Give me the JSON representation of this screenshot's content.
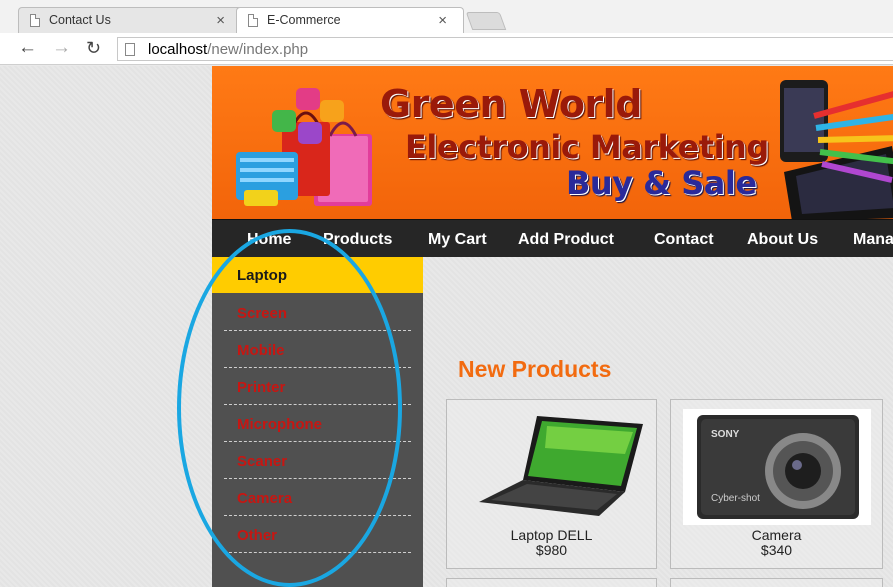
{
  "browser": {
    "tabs": [
      {
        "title": "Contact Us",
        "active": false
      },
      {
        "title": "E-Commerce",
        "active": true
      }
    ],
    "close_glyph": "×",
    "url_host": "localhost",
    "url_path": "/new/index.php",
    "icons": {
      "back": "back-arrow-icon",
      "forward": "forward-arrow-icon",
      "reload": "reload-icon",
      "page": "page-icon"
    }
  },
  "banner": {
    "line1": "Green World",
    "line2": "Electronic Marketing",
    "line3": "Buy & Sale",
    "colors": {
      "background": "#f26b10",
      "title": "#9a1a0a",
      "subtitle": "#2a2a9a"
    }
  },
  "menu": {
    "items": [
      "Home",
      "Products",
      "My Cart",
      "Add Product",
      "Contact",
      "About Us",
      "Mana"
    ]
  },
  "sidebar": {
    "categories": [
      "Laptop",
      "Screen",
      "Mobile",
      "Printer",
      "Microphone",
      "Scaner",
      "Camera",
      "Other"
    ],
    "active": "Laptop",
    "colors": {
      "active_bg": "#ffcc00",
      "link": "#c71612",
      "panel": "#505050"
    }
  },
  "main": {
    "heading": "New Products",
    "products": [
      {
        "name": "Laptop DELL",
        "price": "$980",
        "image": "laptop-image"
      },
      {
        "name": "Camera",
        "price": "$340",
        "image": "camera-image"
      }
    ]
  },
  "annotation": {
    "shape": "ellipse",
    "color": "#1aa7e2"
  }
}
